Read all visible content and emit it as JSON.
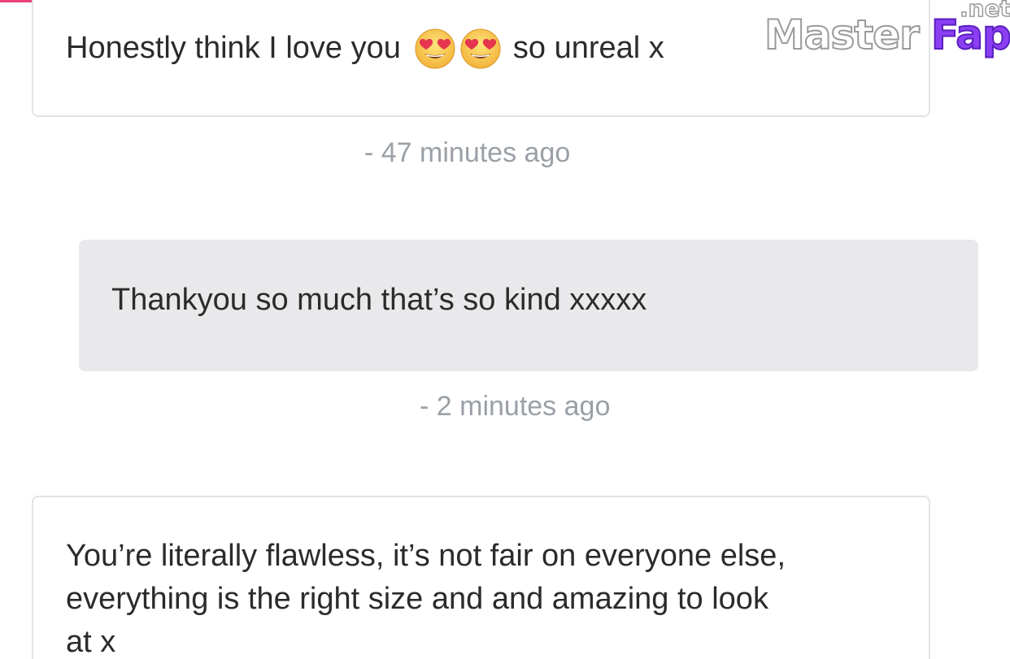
{
  "messages": [
    {
      "direction": "incoming",
      "text_before": "Honestly think I love you",
      "emojis": [
        "heart-eyes-emoji",
        "heart-eyes-emoji"
      ],
      "text_after": "so unreal x"
    },
    {
      "direction": "outgoing",
      "text": "Thankyou so much that’s so kind xxxxx"
    },
    {
      "direction": "incoming",
      "lines": [
        "You’re literally flawless, it’s not fair on everyone else,",
        "everything is the right size and and amazing to look",
        "at x"
      ]
    }
  ],
  "timestamps": [
    "- 47 minutes ago",
    "- 2 minutes ago"
  ],
  "watermark": {
    "part1": "Master",
    "part2": "Fap",
    "part3": ".net"
  },
  "colors": {
    "accent": "#e8407e",
    "incoming_bg": "#ffffff",
    "outgoing_bg": "#e9e9eb",
    "timestamp": "#9aa0a6",
    "text": "#2b2b2b"
  }
}
